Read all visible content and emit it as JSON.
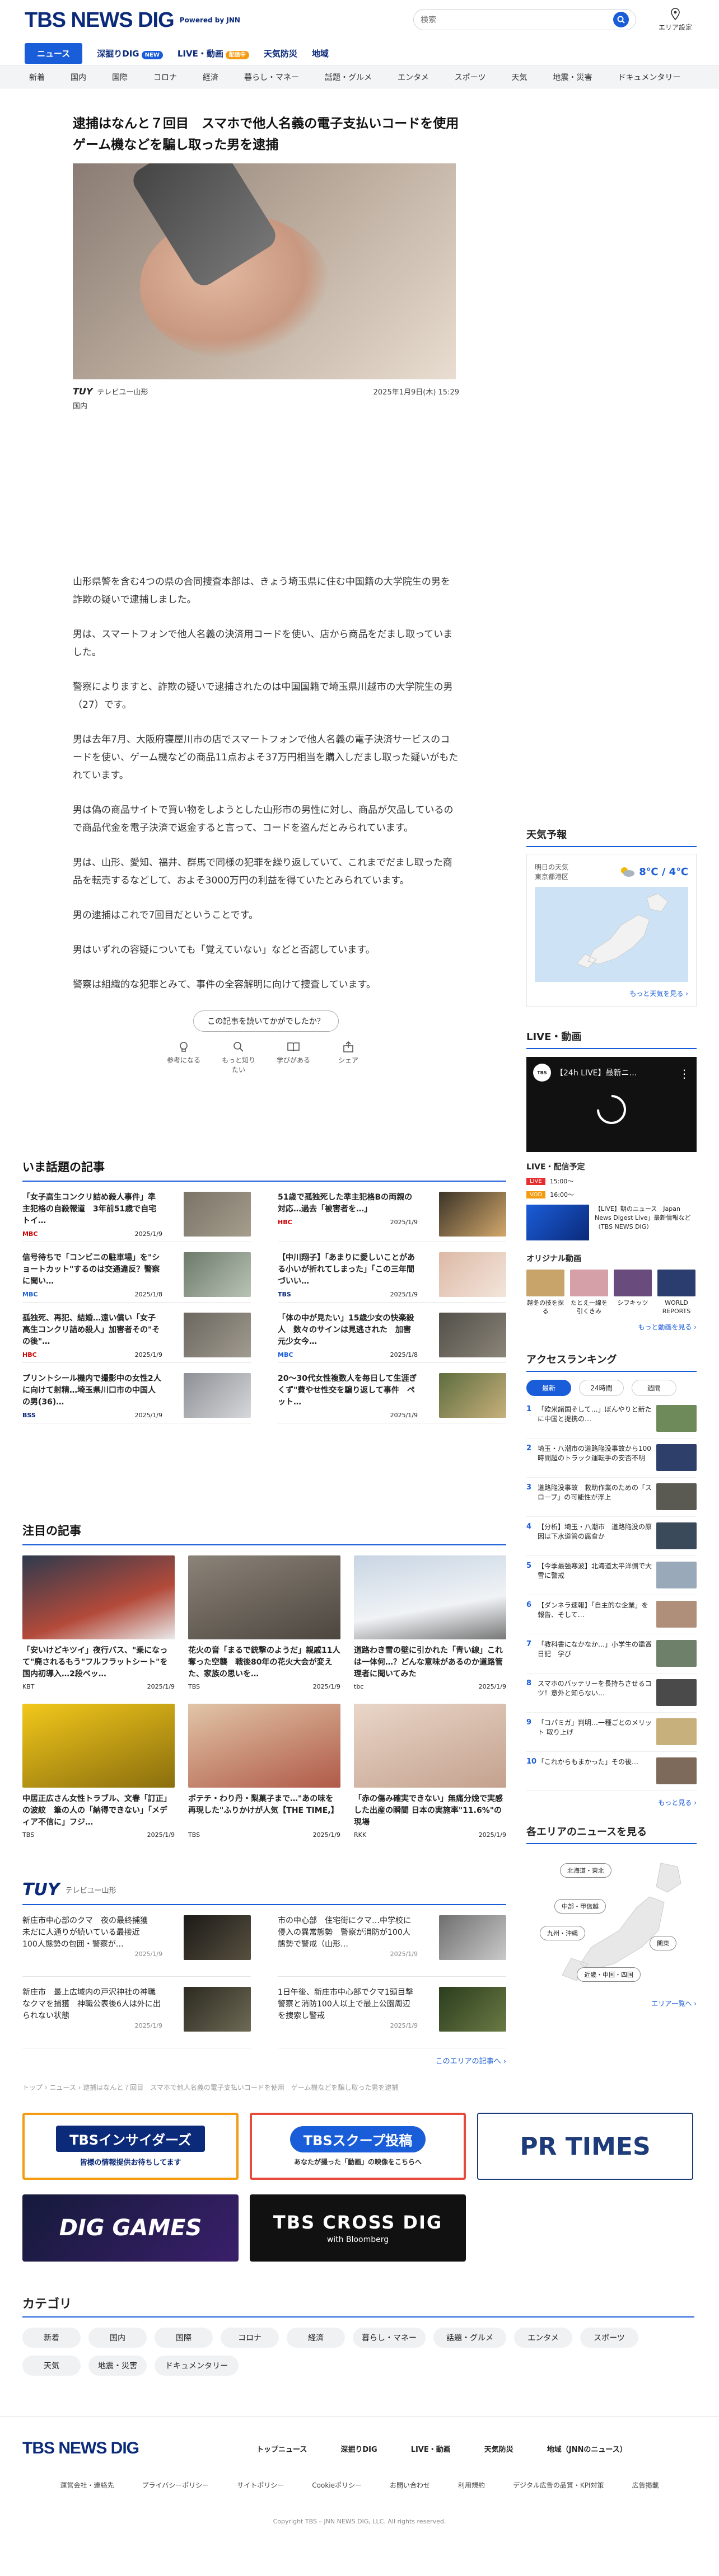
{
  "header": {
    "logo": "TBS NEWS DIG",
    "powered": "Powered by JNN",
    "search_placeholder": "検索",
    "area_setting": "エリア設定"
  },
  "gnav": {
    "news": "ニュース",
    "deep": "深掘りDIG",
    "deep_badge": "NEW",
    "live": "LIVE・動画",
    "live_badge": "配信中",
    "weather": "天気防災",
    "region": "地域"
  },
  "categories": [
    "新着",
    "国内",
    "国際",
    "コロナ",
    "経済",
    "暮らし・マネー",
    "話題・グルメ",
    "エンタメ",
    "スポーツ",
    "天気",
    "地震・災害",
    "ドキュメンタリー"
  ],
  "article": {
    "title": "逮捕はなんと７回目　スマホで他人名義の電子支払いコードを使用　ゲーム機などを騙し取った男を逮捕",
    "source": "テレビユー山形",
    "source_logo": "TUY",
    "datetime": "2025年1月9日(木) 15:29",
    "category": "国内",
    "body": [
      "山形県警を含む4つの県の合同捜査本部は、きょう埼玉県に住む中国籍の大学院生の男を詐欺の疑いで逮捕しました。",
      "男は、スマートフォンで他人名義の決済用コードを使い、店から商品をだまし取っていました。",
      "警察によりますと、詐欺の疑いで逮捕されたのは中国国籍で埼玉県川越市の大学院生の男（27）です。",
      "男は去年7月、大阪府寝屋川市の店でスマートフォンで他人名義の電子決済サービスのコードを使い、ゲーム機などの商品11点およそ37万円相当を購入しだまし取った疑いがもたれています。",
      "男は偽の商品サイトで買い物をしようとした山形市の男性に対し、商品が欠品しているので商品代金を電子決済で返金すると言って、コードを盗んだとみられています。",
      "男は、山形、愛知、福井、群馬で同様の犯罪を繰り返していて、これまでだまし取った商品を転売するなどして、およそ3000万円の利益を得ていたとみられています。",
      "男の逮捕はこれで7回目だということです。",
      "男はいずれの容疑についても「覚えていない」などと否認しています。",
      "警察は組織的な犯罪とみて、事件の全容解明に向けて捜査しています。"
    ],
    "question": "この記事を読いてかがでしたか？",
    "reactions": [
      "参考になる",
      "もっと知りたい",
      "学びがある",
      "シェア"
    ]
  },
  "trending": {
    "title": "いま話題の記事",
    "items": [
      {
        "title": "「女子高生コンクリ詰め殺人事件」準主犯格の自殺報道　3年前51歳で自宅トイ…",
        "outlet": "MBC",
        "date": "2025/1/9"
      },
      {
        "title": "51歳で孤独死した準主犯格Bの両親の対応…過去「被害者を…」",
        "outlet": "HBC",
        "date": "2025/1/9"
      },
      {
        "title": "信号待ちで「コンビニの駐車場」を\"ショートカット\"するのは交通違反？警察に聞い…",
        "outlet": "MBC",
        "date": "2025/1/8"
      },
      {
        "title": "【中川翔子】「あまりに愛しいことがある小いが折れてしまった」「この三年間づいい…",
        "outlet": "TBS",
        "date": "2025/1/9"
      },
      {
        "title": "孤独死、再犯、結婚…遠い償い「女子高生コンクリ詰め殺人」加害者その\"その後\"…",
        "outlet": "HBC",
        "date": "2025/1/9"
      },
      {
        "title": "「体の中が見たい」15歳少女の快楽殺人　数々のサインは見逃された　加害元少女今…",
        "outlet": "MBC",
        "date": "2025/1/8"
      },
      {
        "title": "プリントシール機内で撮影中の女性2人に向けて射精…埼玉県川口市の中国人の男(36)…",
        "outlet": "BSS",
        "date": "2025/1/9"
      },
      {
        "title": "20〜30代女性複数人を毎日して生涯ぎくず\"費やせ性交を騙り返して事件　ペット…",
        "outlet": "",
        "date": "2025/1/9"
      }
    ]
  },
  "featured": {
    "title": "注目の記事",
    "items": [
      {
        "title": "「安いけどキツイ」夜行バス、\"乗になって\"廃されるもう\"フルフラットシート\"を国内初導入…2段ベッ…",
        "outlet": "KBT",
        "date": "2025/1/9"
      },
      {
        "title": "花火の音「まるで銃撃のようだ」親戚11人奪った空襲　戦後80年の花火大会が変えた、家族の思いを…",
        "outlet": "TBS",
        "date": "2025/1/9"
      },
      {
        "title": "道路わき雪の壁に引かれた「青い線」これは一体何…？どんな意味があるのか道路管理者に聞いてみた",
        "outlet": "tbc",
        "date": "2025/1/9"
      },
      {
        "title": "中居正広さん女性トラブル、文春「訂正」の波紋　筆の人の「納得できない」「メディア不信に」フジ…",
        "outlet": "TBS",
        "date": "2025/1/9"
      },
      {
        "title": "ポテチ・わり丹・梨菓子まで…\"あの味を再現した\"ふりかけが人気【THE TIME,】",
        "outlet": "TBS",
        "date": "2025/1/9"
      },
      {
        "title": "「赤の傷み確実できない」無痛分娩で実感した出産の瞬間 日本の実施率\"11.6%\"の現場",
        "outlet": "RKK",
        "date": "2025/1/9"
      }
    ]
  },
  "local": {
    "logo": "TUY",
    "name": "テレビユー山形",
    "items": [
      {
        "title": "新庄市中心部のクマ　夜の最終捕獲　未だに人通りが続いている最接近　100人態勢の包囲・警察が…",
        "date": "2025/1/9"
      },
      {
        "title": "市の中心部　住宅街にクマ…中学校に侵入の異常態勢　警察が消防が100人態勢で警戒（山形…",
        "date": "2025/1/9"
      },
      {
        "title": "新庄市　最上広域内の戸沢神社の神職なクマを捕獲　神職公表後6人は外に出られない状態",
        "date": "2025/1/9"
      },
      {
        "title": "1日午後、新庄市中心部でクマ1頭目撃　警察と消防100人以上で最上公園周辺を捜索し警戒",
        "date": "2025/1/9"
      }
    ],
    "more": "このエリアの記事へ ›"
  },
  "breadcrumb": "トップ › ニュース › 逮捕はなんと７回目　スマホで他人名義の電子支払いコードを使用　ゲーム機などを騙し取った男を逮捕",
  "banners": [
    {
      "label": "TBSインサイダーズ",
      "sub": "皆様の情報提供お待ちしてます"
    },
    {
      "label": "TBSスクープ投稿",
      "sub": "あなたが撮った「動画」の映像をこちらへ"
    },
    {
      "label": "PR TIMES"
    },
    {
      "label": "DIG GAMES"
    },
    {
      "label": "TBS CROSS DIG",
      "sub": "with Bloomberg"
    }
  ],
  "category_section": {
    "title": "カテゴリ",
    "items": [
      "新着",
      "国内",
      "国際",
      "コロナ",
      "経済",
      "暮らし・マネー",
      "話題・グルメ",
      "エンタメ",
      "スポーツ",
      "天気",
      "地震・災害",
      "ドキュメンタリー"
    ]
  },
  "footer": {
    "logo": "TBS NEWS DIG",
    "nav": [
      "トップニュース",
      "深掘りDIG",
      "LIVE・動画",
      "天気防災",
      "地域（JNNのニュース）"
    ],
    "links": [
      "運営会社・連絡先",
      "プライバシーポリシー",
      "サイトポリシー",
      "Cookieポリシー",
      "お問い合わせ",
      "利用規約",
      "デジタル広告の品質・KPI対策",
      "広告掲載"
    ],
    "copyright": "Copyright TBS – JNN NEWS DIG, LLC. All rights reserved."
  },
  "sidebar": {
    "weather": {
      "title": "天気予報",
      "place": "明日の天気",
      "city": "東京都港区",
      "temp": "8℃ / 4℃",
      "more": "もっと天気を見る ›"
    },
    "live": {
      "title": "LIVE・動画",
      "player_label": "【24h LIVE】最新ニ…",
      "schedule_title": "LIVE・配信予定",
      "sched": [
        {
          "tag": "LIVE",
          "time": "15:00〜"
        },
        {
          "tag": "VOD",
          "time": "16:00〜"
        }
      ],
      "program": "【LIVE】朝のニュース　Japan News Digest Live」最新情報など（TBS NEWS DIG）",
      "orig_title": "オリジナル動画",
      "orig": [
        "越冬の技を探る",
        "たとえ一線を引くきみ",
        "シフキッツ",
        "WORLD REPORTS"
      ],
      "more": "もっと動画を見る ›"
    },
    "ranking": {
      "title": "アクセスランキング",
      "tabs": [
        "最新",
        "24時間",
        "週間"
      ],
      "items": [
        "「欧米諸国そして…」ぼんやりと新たに中国と提携の…",
        "埼玉・八潮市の道路陥没事故から100時間超のトラック運転手の安否不明",
        "道路陥没事故　救助作業のための「スロープ」の可能性が浮上",
        "【分析】埼玉・八潮市　道路陥没の原因は下水道管の腐食か",
        "【今季最強寒波】北海道太平洋側で大雪に警戒",
        "【ダンネラ速報】「自主的な企業」を報告、そして…",
        "「教科書になかなか…」小学生の鑑賞日記　学び",
        "スマホのバッテリーを長持ちさせるコツ！意外と知らない…",
        "「コパミガ」判明…一種ごとのメリット 取り上げ",
        "「これからもまかった」その後…"
      ],
      "more": "もっと見る ›"
    },
    "area": {
      "title": "各エリアのニュースを見る",
      "pills": [
        "北海道・東北",
        "中部・甲信越",
        "九州・沖縄",
        "関東",
        "近畿・中国・四国"
      ],
      "more": "エリア一覧へ ›"
    }
  }
}
